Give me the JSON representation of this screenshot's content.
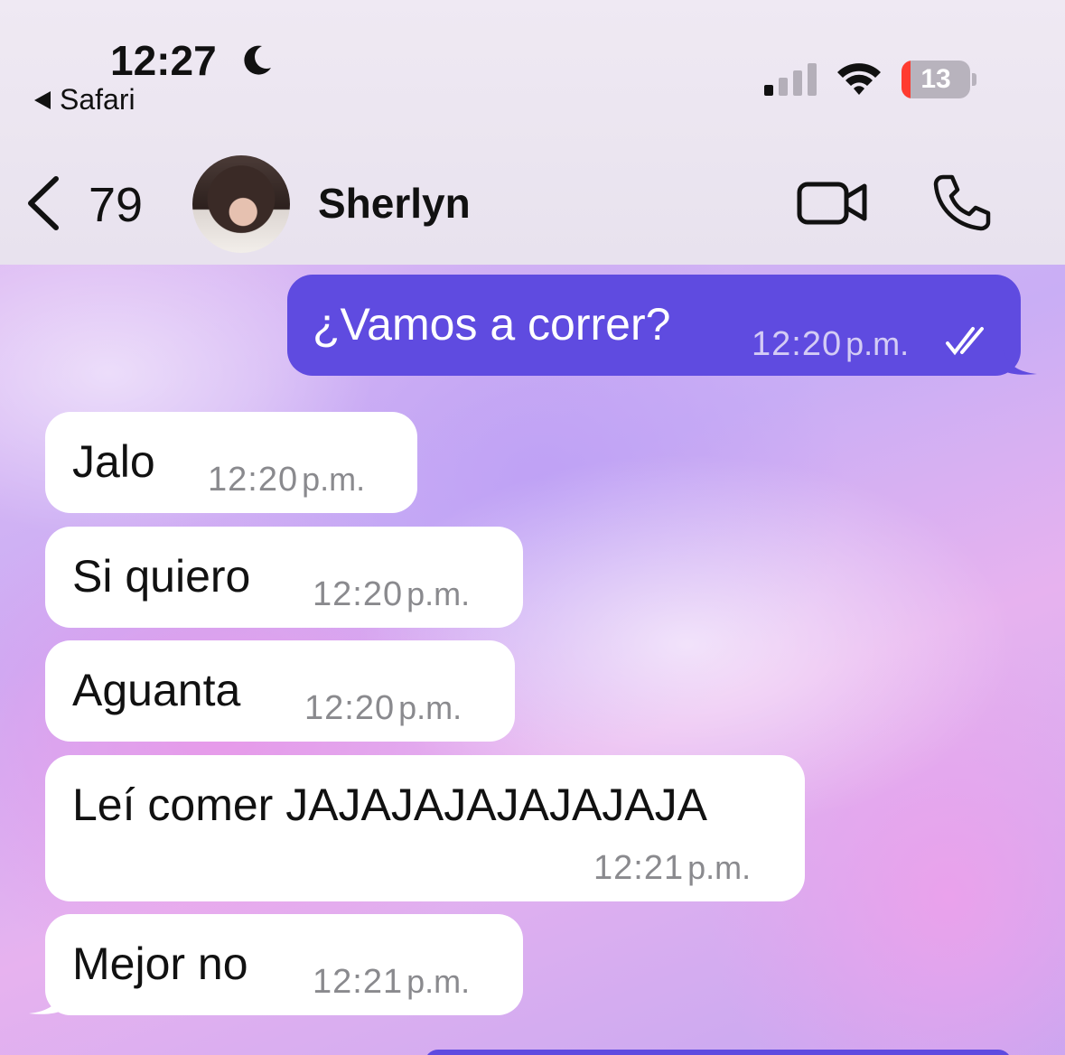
{
  "status_bar": {
    "time": "12:27",
    "back_app": "Safari",
    "battery_level": 13,
    "battery_label": "13",
    "icons": [
      "moon-icon",
      "signal-icon",
      "wifi-icon",
      "battery-icon"
    ]
  },
  "header": {
    "back_count": "79",
    "contact_name": "Sherlyn",
    "icons": [
      "chevron-left-icon",
      "video-call-icon",
      "phone-icon"
    ]
  },
  "messages": [
    {
      "direction": "outgoing",
      "text": "¿Vamos a correr?",
      "time": "12:20",
      "ampm": "p.m.",
      "status": "read"
    },
    {
      "direction": "incoming",
      "text": "Jalo",
      "time": "12:20",
      "ampm": "p.m."
    },
    {
      "direction": "incoming",
      "text": "Si quiero",
      "time": "12:20",
      "ampm": "p.m."
    },
    {
      "direction": "incoming",
      "text": "Aguanta",
      "time": "12:20",
      "ampm": "p.m."
    },
    {
      "direction": "incoming",
      "text": "Leí comer JAJAJAJAJAJAJAJA",
      "time": "12:21",
      "ampm": "p.m."
    },
    {
      "direction": "incoming",
      "text": "Mejor no",
      "time": "12:21",
      "ampm": "p.m."
    }
  ],
  "colors": {
    "outgoing_bubble": "#5f4be0",
    "incoming_bubble": "#ffffff",
    "battery_low": "#ff3b30"
  }
}
